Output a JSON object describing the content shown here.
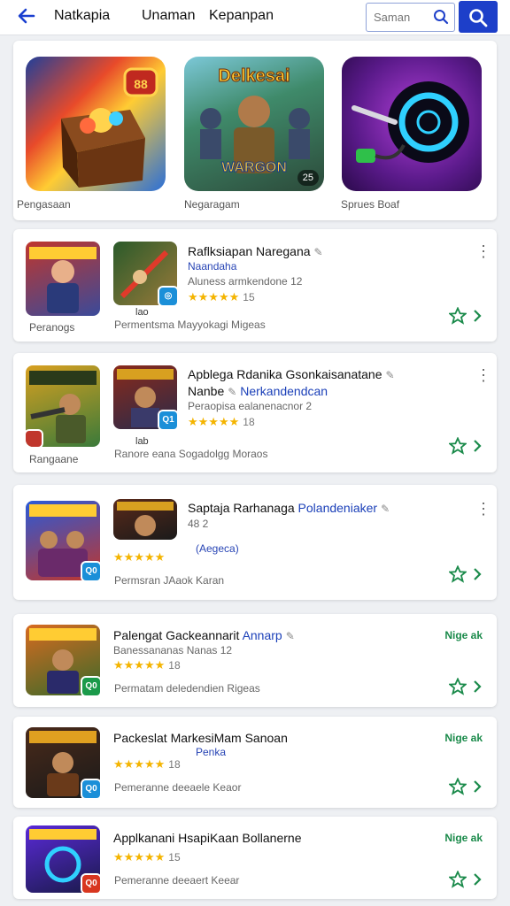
{
  "header": {
    "nav": [
      "Natkapia",
      "Unaman",
      "Kepanpan"
    ],
    "search_placeholder": "Saman"
  },
  "featured": {
    "items": [
      {
        "caption": "Pengasaan",
        "badge": ""
      },
      {
        "caption": "Negaragam",
        "badge": "25"
      },
      {
        "caption": "Sprues Boaf",
        "badge": ""
      }
    ]
  },
  "apps": [
    {
      "thumb_caption": "Peranogs",
      "under_caption": "lao",
      "mini_badge": "◎",
      "title": "Raflksiapan Naregana",
      "subtitle_link": "Naandaha",
      "meta": "Aluness armkendone 12",
      "rating_num": "15",
      "footer": "Permentsma Mayyokagi Migeas",
      "tag": ""
    },
    {
      "thumb_caption": "Rangaane",
      "under_caption": "lab",
      "mini_badge": "Q1",
      "title": "Apblega Rdanika Gsonkaisanatane",
      "title2": "Nanbe",
      "title2_link": "Nerkandendcan",
      "meta": "Peraopisa ealanenacnor 2",
      "rating_num": "18",
      "footer": "Ranore eana Sogadolgg Moraos",
      "tag": ""
    },
    {
      "thumb_caption": "",
      "under_caption": "",
      "mini_badge": "Q0",
      "title": "Saptaja Rarhanaga",
      "title_link": "Polandeniaker",
      "meta": "48 2",
      "rating_num": "",
      "sub_link": "(Aegeca)",
      "footer": "Permsran JAaok Karan",
      "tag": ""
    },
    {
      "thumb_caption": "",
      "under_caption": "",
      "mini_badge": "Q0",
      "title": "Palengat Gackeannarit",
      "title_link": "Annarp",
      "meta": "Banessananas Nanas 12",
      "rating_num": "18",
      "footer": "Permatam deledendien Rigeas",
      "tag": "Nige ak"
    },
    {
      "thumb_caption": "",
      "under_caption": "",
      "mini_badge": "Q0",
      "title": "Packeslat MarkesiMam Sanoan",
      "sub_link": "Penka",
      "meta": "",
      "rating_num": "18",
      "footer": "Pemeranne deeaele Keaor",
      "tag": "Nige ak"
    },
    {
      "thumb_caption": "",
      "under_caption": "",
      "mini_badge": "Q0",
      "title": "Applkanani HsapiKaan Bollanerne",
      "meta": "",
      "rating_num": "15",
      "footer": "Pemeranne deeaert Keear",
      "tag": "Nige ak"
    }
  ],
  "colors": {
    "accent": "#1d3fc9",
    "star": "#f4b400",
    "green": "#1a8a4a"
  }
}
